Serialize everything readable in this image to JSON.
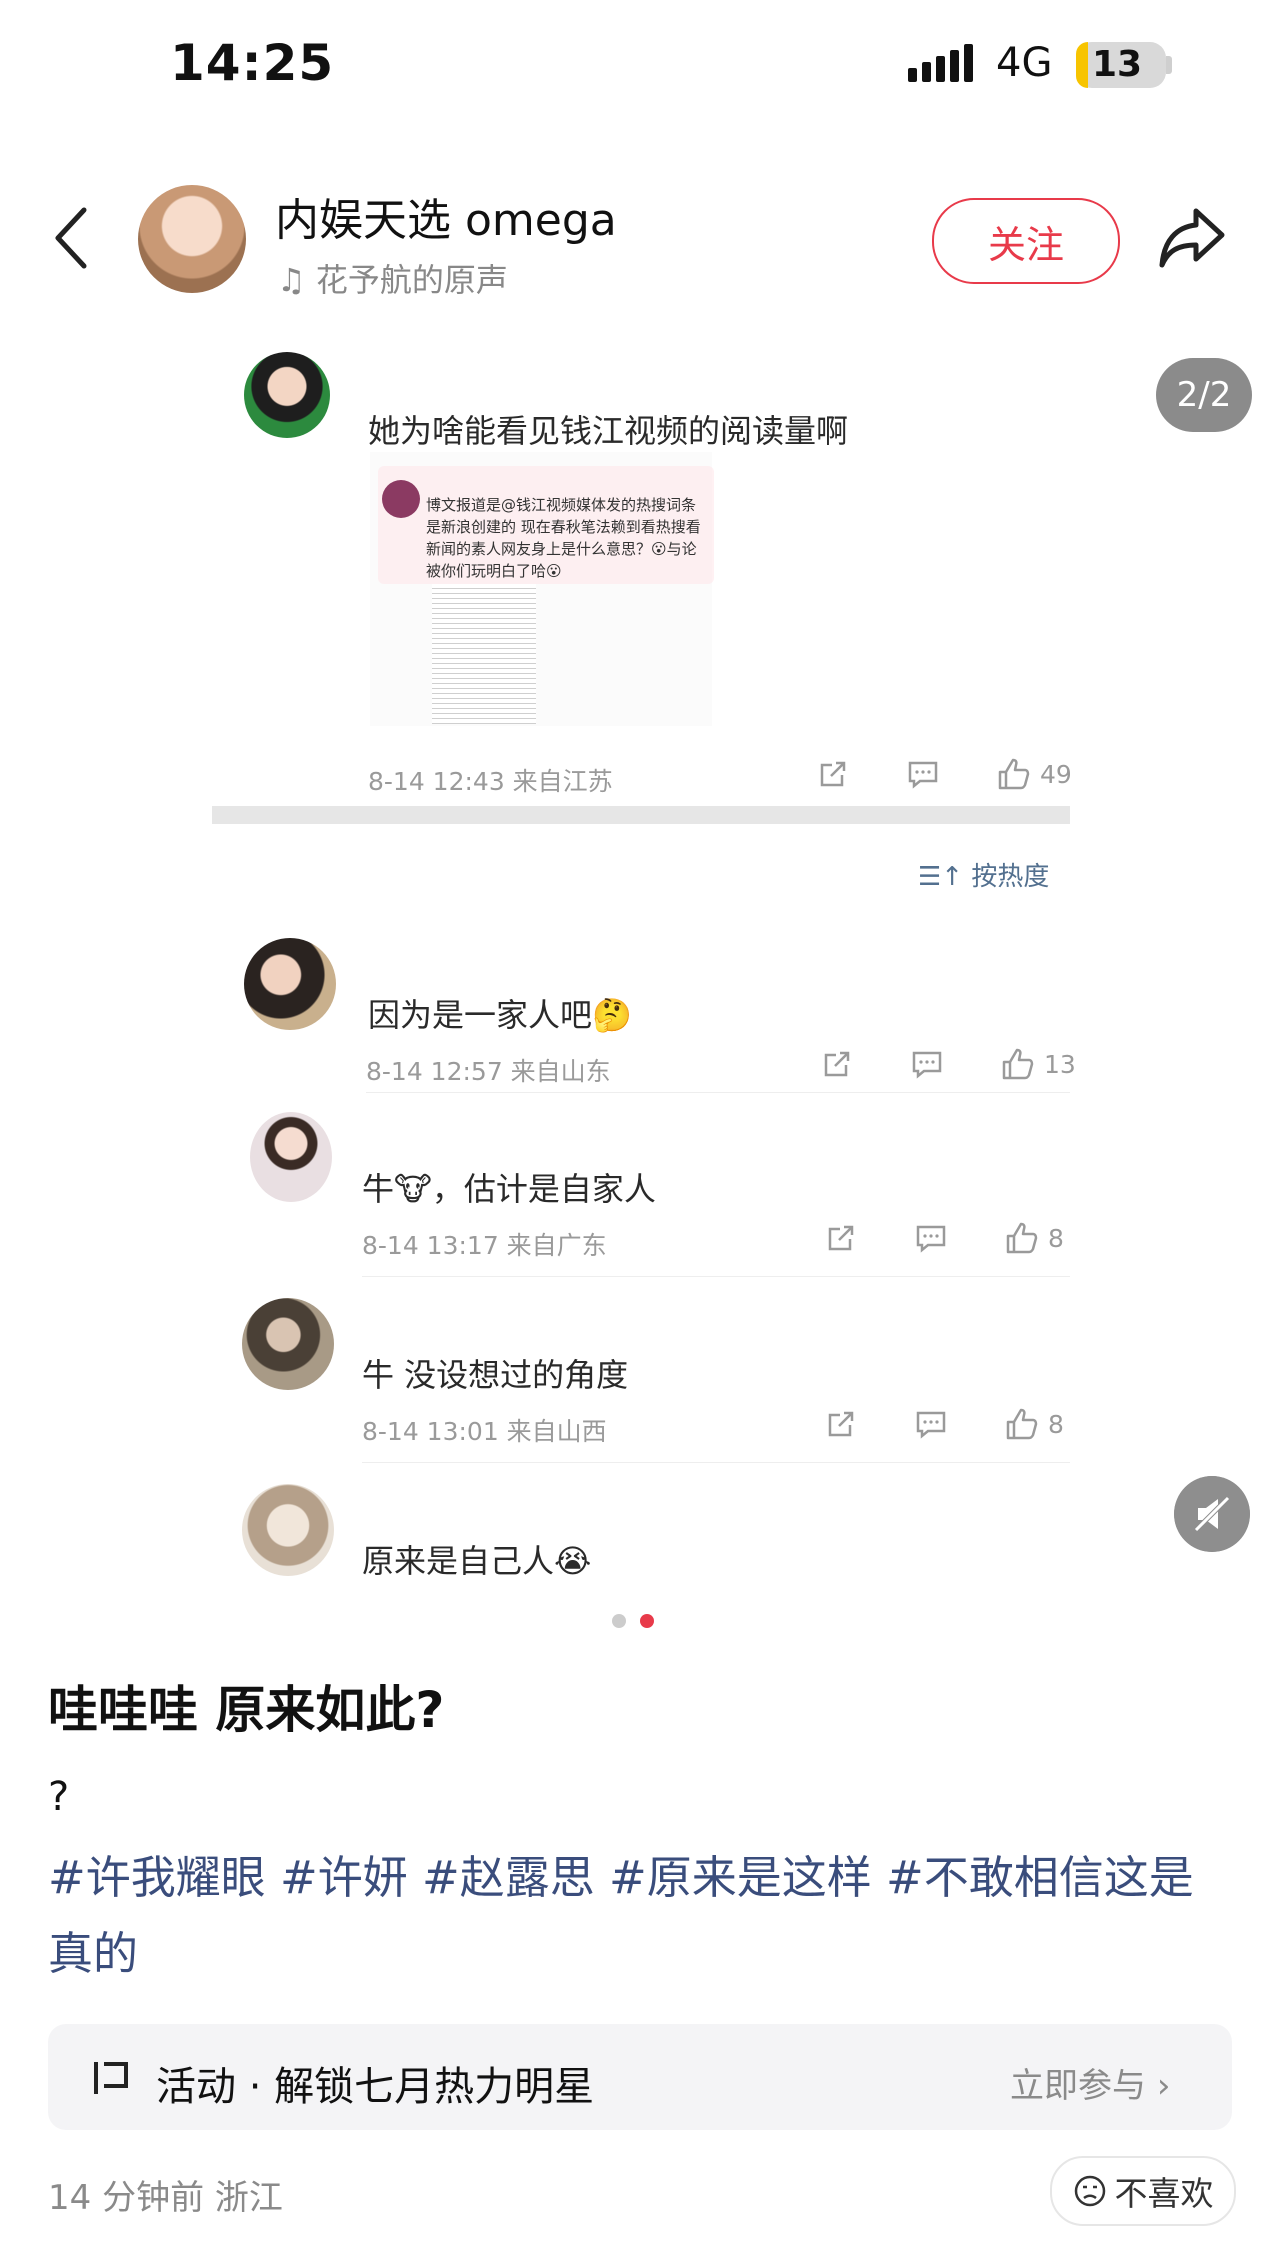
{
  "status_bar": {
    "time": "14:25",
    "network": "4G",
    "battery": "13"
  },
  "header": {
    "author": "内娱天选 omega",
    "music": "花予航的原声",
    "follow_label": "关注"
  },
  "image": {
    "page_indicator": "2/2",
    "original_comment": {
      "text": "她为啥能看见钱江视频的阅读量啊",
      "meta": "8-14 12:43 来自江苏",
      "likes": "49",
      "embedded_text": "博文报道是@钱江视频媒体发的热搜词条是新浪创建的 现在春秋笔法赖到看热搜看新闻的素人网友身上是什么意思？😮与论被你们玩明白了哈😮"
    },
    "sort_label": "按热度",
    "replies": [
      {
        "text": "因为是一家人吧🤔",
        "meta": "8-14 12:57 来自山东",
        "likes": "13"
      },
      {
        "text": "牛🐮，估计是自家人",
        "meta": "8-14 13:17 来自广东",
        "likes": "8"
      },
      {
        "text": "牛 没设想过的角度",
        "meta": "8-14 13:01 来自山西",
        "likes": "8"
      },
      {
        "text": "原来是自己人😭"
      }
    ],
    "carousel": {
      "total": 2,
      "active": 2
    }
  },
  "post": {
    "title": "哇哇哇 原来如此?",
    "question": "?",
    "tags": "#许我耀眼 #许妍 #赵露思 #原来是这样 #不敢相信这是真的"
  },
  "activity": {
    "label": "活动 · 解锁七月热力明星",
    "cta": "立即参与"
  },
  "footer": {
    "time_location": "14 分钟前 浙江",
    "dislike_label": "不喜欢"
  },
  "colors": {
    "accent_red": "#e83a4a",
    "tag_blue": "#3a4d7c"
  }
}
